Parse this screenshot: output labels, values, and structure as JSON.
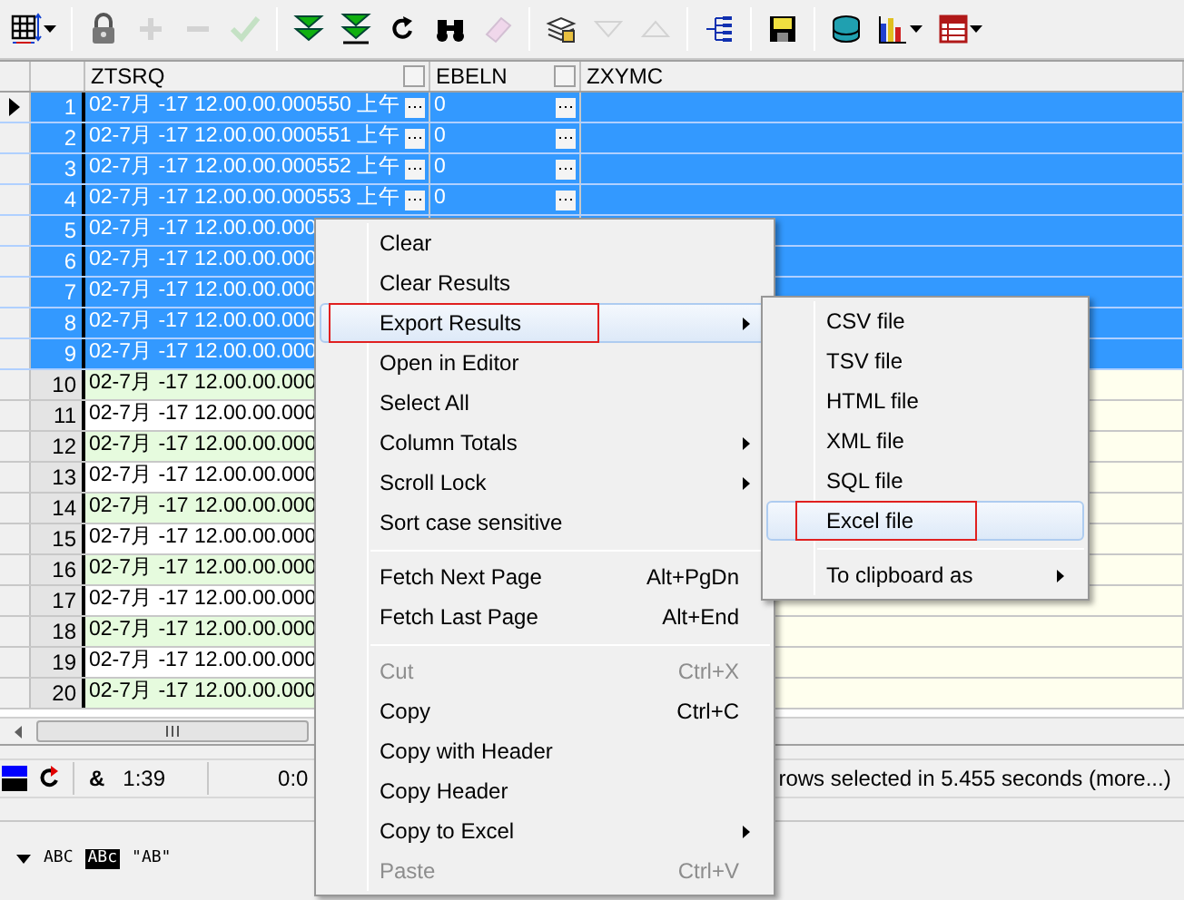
{
  "toolbar": [
    [
      {
        "kind": "grid",
        "disabled": false,
        "dropdown": true
      }
    ],
    [
      {
        "kind": "lock",
        "disabled": false,
        "dropdown": false
      },
      {
        "kind": "plus",
        "disabled": true,
        "dropdown": false
      },
      {
        "kind": "minus",
        "disabled": true,
        "dropdown": false
      },
      {
        "kind": "check",
        "disabled": true,
        "dropdown": false
      }
    ],
    [
      {
        "kind": "double-down",
        "disabled": false,
        "dropdown": false
      },
      {
        "kind": "double-down-bar",
        "disabled": false,
        "dropdown": false
      },
      {
        "kind": "refresh",
        "disabled": false,
        "dropdown": false
      },
      {
        "kind": "binoculars",
        "disabled": false,
        "dropdown": false
      },
      {
        "kind": "eraser",
        "disabled": true,
        "dropdown": false
      }
    ],
    [
      {
        "kind": "pages",
        "disabled": false,
        "dropdown": false
      },
      {
        "kind": "triangle-down",
        "disabled": true,
        "dropdown": false
      },
      {
        "kind": "triangle-up",
        "disabled": true,
        "dropdown": false
      }
    ],
    [
      {
        "kind": "tree",
        "disabled": false,
        "dropdown": false
      }
    ],
    [
      {
        "kind": "save",
        "disabled": false,
        "dropdown": false
      }
    ],
    [
      {
        "kind": "database",
        "disabled": false,
        "dropdown": false
      },
      {
        "kind": "chart",
        "disabled": false,
        "dropdown": true
      },
      {
        "kind": "table",
        "disabled": false,
        "dropdown": true
      }
    ]
  ],
  "grid": {
    "columns": [
      "ZTSRQ",
      "EBELN",
      "ZXYMC"
    ],
    "rows": [
      {
        "number": "1",
        "current": true,
        "selected": true,
        "ztsrq": "02-7月 -17 12.00.00.000550 上午",
        "ebeln": "0",
        "cell_buttons": true
      },
      {
        "number": "2",
        "current": false,
        "selected": true,
        "ztsrq": "02-7月 -17 12.00.00.000551 上午",
        "ebeln": "0",
        "cell_buttons": true
      },
      {
        "number": "3",
        "current": false,
        "selected": true,
        "ztsrq": "02-7月 -17 12.00.00.000552 上午",
        "ebeln": "0",
        "cell_buttons": true
      },
      {
        "number": "4",
        "current": false,
        "selected": true,
        "ztsrq": "02-7月 -17 12.00.00.000553 上午",
        "ebeln": "0",
        "cell_buttons": true
      },
      {
        "number": "5",
        "current": false,
        "selected": true,
        "ztsrq": "02-7月 -17 12.00.00.000"
      },
      {
        "number": "6",
        "current": false,
        "selected": true,
        "ztsrq": "02-7月 -17 12.00.00.000"
      },
      {
        "number": "7",
        "current": false,
        "selected": true,
        "ztsrq": "02-7月 -17 12.00.00.000"
      },
      {
        "number": "8",
        "current": false,
        "selected": true,
        "ztsrq": "02-7月 -17 12.00.00.000"
      },
      {
        "number": "9",
        "current": false,
        "selected": true,
        "ztsrq": "02-7月 -17 12.00.00.000"
      },
      {
        "number": "10",
        "current": false,
        "selected": false,
        "ztsrq": "02-7月 -17 12.00.00.000"
      },
      {
        "number": "11",
        "current": false,
        "selected": false,
        "ztsrq": "02-7月 -17 12.00.00.000"
      },
      {
        "number": "12",
        "current": false,
        "selected": false,
        "ztsrq": "02-7月 -17 12.00.00.000"
      },
      {
        "number": "13",
        "current": false,
        "selected": false,
        "ztsrq": "02-7月 -17 12.00.00.000"
      },
      {
        "number": "14",
        "current": false,
        "selected": false,
        "ztsrq": "02-7月 -17 12.00.00.000"
      },
      {
        "number": "15",
        "current": false,
        "selected": false,
        "ztsrq": "02-7月 -17 12.00.00.000"
      },
      {
        "number": "16",
        "current": false,
        "selected": false,
        "ztsrq": "02-7月 -17 12.00.00.000"
      },
      {
        "number": "17",
        "current": false,
        "selected": false,
        "ztsrq": "02-7月 -17 12.00.00.000"
      },
      {
        "number": "18",
        "current": false,
        "selected": false,
        "ztsrq": "02-7月 -17 12.00.00.000"
      },
      {
        "number": "19",
        "current": false,
        "selected": false,
        "ztsrq": "02-7月 -17 12.00.00.000"
      },
      {
        "number": "20",
        "current": false,
        "selected": false,
        "ztsrq": "02-7月 -17 12.00.00.000"
      }
    ]
  },
  "status_bar": {
    "symbol": "&",
    "time": "1:39",
    "elapsed": "0:0",
    "message": "rows selected in 5.455 seconds (more...)"
  },
  "format_buttons": [
    {
      "label": "ABC",
      "kind": "plain"
    },
    {
      "label": "ABc",
      "kind": "inverted"
    },
    {
      "label": "\"AB\"",
      "kind": "plain"
    }
  ],
  "context_menu": {
    "items": [
      {
        "kind": "item",
        "label": "Clear",
        "disabled": false,
        "submenu": false,
        "selected": false,
        "marked": false
      },
      {
        "kind": "item",
        "label": "Clear Results",
        "disabled": false,
        "submenu": false,
        "selected": false,
        "marked": false
      },
      {
        "kind": "item",
        "label": "Export Results",
        "disabled": false,
        "submenu": true,
        "selected": true,
        "marked": true
      },
      {
        "kind": "item",
        "label": "Open in Editor",
        "disabled": false,
        "submenu": false,
        "selected": false,
        "marked": false
      },
      {
        "kind": "item",
        "label": "Select All",
        "disabled": false,
        "submenu": false,
        "selected": false,
        "marked": false
      },
      {
        "kind": "item",
        "label": "Column Totals",
        "disabled": false,
        "submenu": true,
        "selected": false,
        "marked": false
      },
      {
        "kind": "item",
        "label": "Scroll Lock",
        "disabled": false,
        "submenu": true,
        "selected": false,
        "marked": false
      },
      {
        "kind": "item",
        "label": "Sort case sensitive",
        "disabled": false,
        "submenu": false,
        "selected": false,
        "marked": false
      },
      {
        "kind": "separator"
      },
      {
        "kind": "item",
        "label": "Fetch Next Page",
        "shortcut": "Alt+PgDn",
        "disabled": false,
        "submenu": false,
        "selected": false,
        "marked": false
      },
      {
        "kind": "item",
        "label": "Fetch Last Page",
        "shortcut": "Alt+End",
        "disabled": false,
        "submenu": false,
        "selected": false,
        "marked": false
      },
      {
        "kind": "separator"
      },
      {
        "kind": "item",
        "label": "Cut",
        "shortcut": "Ctrl+X",
        "disabled": true,
        "submenu": false,
        "selected": false,
        "marked": false
      },
      {
        "kind": "item",
        "label": "Copy",
        "shortcut": "Ctrl+C",
        "disabled": false,
        "submenu": false,
        "selected": false,
        "marked": false
      },
      {
        "kind": "item",
        "label": "Copy with Header",
        "disabled": false,
        "submenu": false,
        "selected": false,
        "marked": false
      },
      {
        "kind": "item",
        "label": "Copy Header",
        "disabled": false,
        "submenu": false,
        "selected": false,
        "marked": false
      },
      {
        "kind": "item",
        "label": "Copy to Excel",
        "disabled": false,
        "submenu": true,
        "selected": false,
        "marked": false
      },
      {
        "kind": "item",
        "label": "Paste",
        "shortcut": "Ctrl+V",
        "disabled": true,
        "submenu": false,
        "selected": false,
        "marked": false
      }
    ]
  },
  "export_submenu": {
    "items": [
      {
        "kind": "item",
        "label": "CSV file",
        "disabled": false,
        "submenu": false,
        "selected": false,
        "marked": false
      },
      {
        "kind": "item",
        "label": "TSV file",
        "disabled": false,
        "submenu": false,
        "selected": false,
        "marked": false
      },
      {
        "kind": "item",
        "label": "HTML file",
        "disabled": false,
        "submenu": false,
        "selected": false,
        "marked": false
      },
      {
        "kind": "item",
        "label": "XML file",
        "disabled": false,
        "submenu": false,
        "selected": false,
        "marked": false
      },
      {
        "kind": "item",
        "label": "SQL file",
        "disabled": false,
        "submenu": false,
        "selected": false,
        "marked": false
      },
      {
        "kind": "item",
        "label": "Excel file",
        "disabled": false,
        "submenu": false,
        "selected": true,
        "marked": true
      },
      {
        "kind": "separator"
      },
      {
        "kind": "item",
        "label": "To clipboard as",
        "disabled": false,
        "submenu": true,
        "selected": false,
        "marked": false
      }
    ]
  }
}
